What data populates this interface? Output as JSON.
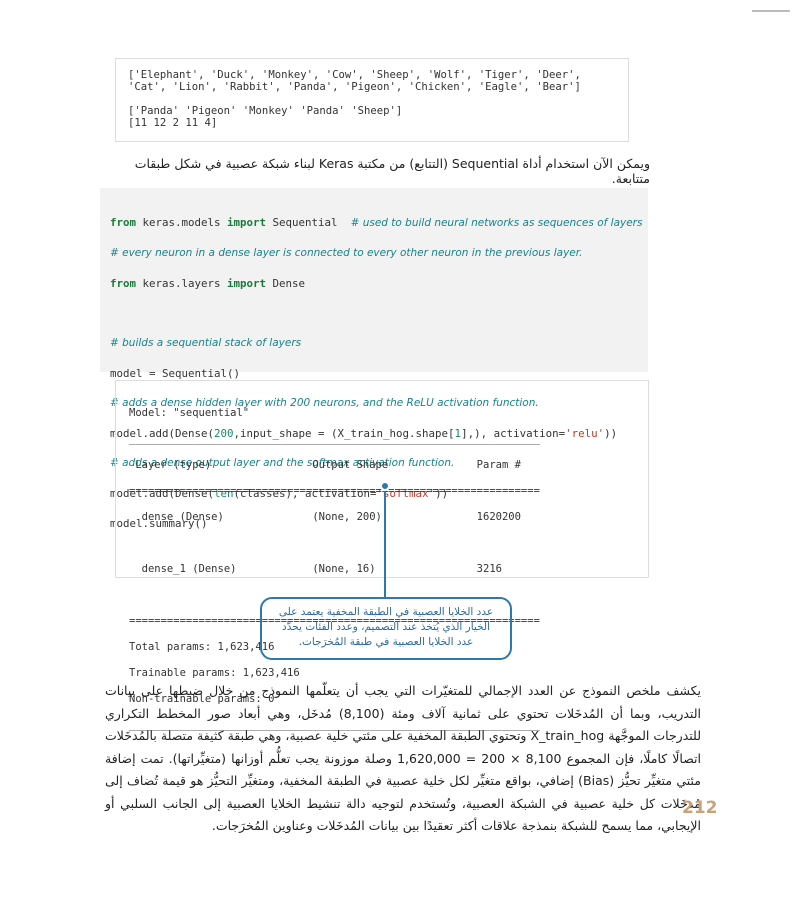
{
  "output1": {
    "lines": [
      "['Elephant', 'Duck', 'Monkey', 'Cow', 'Sheep', 'Wolf', 'Tiger', 'Deer',",
      "'Cat', 'Lion', 'Rabbit', 'Panda', 'Pigeon', 'Chicken', 'Eagle', 'Bear']",
      "",
      "['Panda' 'Pigeon' 'Monkey' 'Panda' 'Sheep']",
      "[11 12 2 11 4]"
    ]
  },
  "intro_text": "ويمكن الآن استخدام أداة Sequential (التتابع) من مكتبة Keras لبناء شبكة عصبية في شكل طبقات متتابعة.",
  "code": {
    "l1_from": "from",
    "l1_mod": " keras.models ",
    "l1_import": "import",
    "l1_rest": " Sequential  ",
    "l1_comment": "# used to build neural networks as sequences of layers",
    "l2_comment": "# every neuron in a dense layer is connected to every other neuron in the previous layer.",
    "l3_from": "from",
    "l3_mod": " keras.layers ",
    "l3_import": "import",
    "l3_rest": " Dense",
    "l5_comment": "# builds a sequential stack of layers",
    "l6": "model = Sequential()",
    "l7_comment": "# adds a dense hidden layer with 200 neurons, and the ReLU activation function.",
    "l8_a": "model.add(Dense(",
    "l8_num": "200",
    "l8_b": ",input_shape = (X_train_hog.shape[",
    "l8_num2": "1",
    "l8_c": "],), activation=",
    "l8_str": "'relu'",
    "l8_d": "))",
    "l9_comment": "# adds a dense output layer and the softmax activation function.",
    "l10_a": "model.add(Dense(",
    "l10_fn": "len",
    "l10_b": "(classes), activation=",
    "l10_str": "'softmax'",
    "l10_c": "))",
    "l11": "model.summary()"
  },
  "summary": {
    "lines": [
      "Model: \"sequential\"",
      "_________________________________________________________________",
      " Layer (type)                Output Shape              Param #   ",
      "=================================================================",
      "  dense (Dense)              (None, 200)               1620200   ",
      "",
      "  dense_1 (Dense)            (None, 16)                3216      ",
      "",
      "=================================================================",
      "Total params: 1,623,416",
      "Trainable params: 1,623,416",
      "Non-trainable params: 0",
      "_________________________________________________________________"
    ]
  },
  "callout": "عدد الخلايا العصبية في الطبقة المخفية يعتمد على الخيار الذي يُتخذ عند التصميم، وعدد الفئات يحدّد عدد الخلايا العصبية في طبقة المُخرَجات.",
  "paragraph": "يكشف ملخص النموذج عن العدد الإجمالي للمتغيّرات التي يجب أن يتعلّمها النموذج من خلال ضبطها على بيانات التدريب، وبما أن المُدخَلات تحتوي على ثمانية آلاف ومئة (8,100) مُدخَل، وهي أبعاد صور المخطط التكراري للتدرجات الموجَّهة X_train_hog وتحتوي الطبقة المخفية على مئتي خلية عصبية، وهي طبقة كثيفة متصلة بالمُدخَلات اتصالًا كاملًا، فإن المجموع 8,100 × 200 = 1,620,000 وصلة موزونة يجب تعلُّم أوزانها (متغيِّراتها). تمت إضافة مئتي متغيِّر تحيُّز (Bias) إضافي، بواقع متغيِّر لكل خلية عصبية في الطبقة المخفية، ومتغيِّر التحيُّز هو قيمة تُضاف إلى مُدخَلات كل خلية عصبية في الشبكة العصبية، وتُستخدم لتوجيه دالة تنشيط الخلايا العصبية إلى الجانب السلبي أو الإيجابي، مما يسمح للشبكة بنمذجة علاقات أكثر تعقيدًا بين بيانات المُدخَلات وعناوين المُخرَجات.",
  "page_number": "212",
  "colors": {
    "accent": "#2a7ab0",
    "page_number": "#c9a27a",
    "keyword": "#1a7a3a",
    "comment": "#17838c",
    "string": "#c0392b"
  }
}
